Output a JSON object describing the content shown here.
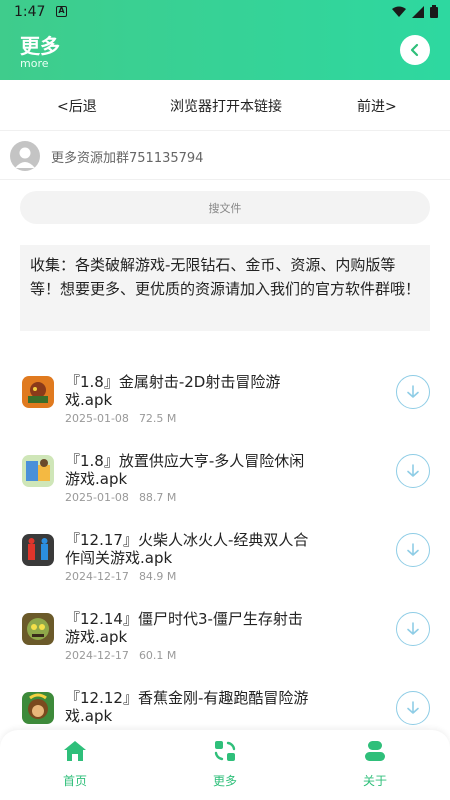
{
  "status": {
    "time": "1:47",
    "notif": "A"
  },
  "header": {
    "title": "更多",
    "subtitle": "more"
  },
  "nav": {
    "back": "<后退",
    "open_browser": "浏览器打开本链接",
    "forward": "前进>"
  },
  "notice": {
    "text": "更多资源加群751135794"
  },
  "search": {
    "placeholder": "搜文件"
  },
  "intro": {
    "text": "收集：各类破解游戏-无限钻石、金币、资源、内购版等等！想要更多、更优质的资源请加入我们的官方软件群哦！"
  },
  "files": [
    {
      "name": "『1.8』金属射击-2D射击冒险游戏.apk",
      "date": "2025-01-08",
      "size": "72.5 M",
      "icon": "metal-shooter-icon"
    },
    {
      "name": "『1.8』放置供应大亨-多人冒险休闲游戏.apk",
      "date": "2025-01-08",
      "size": "88.7 M",
      "icon": "supply-tycoon-icon"
    },
    {
      "name": "『12.17』火柴人冰火人-经典双人合作闯关游戏.apk",
      "date": "2024-12-17",
      "size": "84.9 M",
      "icon": "stickman-icon"
    },
    {
      "name": "『12.14』僵尸时代3-僵尸生存射击游戏.apk",
      "date": "2024-12-17",
      "size": "60.1 M",
      "icon": "zombie-age-icon"
    },
    {
      "name": "『12.12』香蕉金刚-有趣跑酷冒险游戏.apk",
      "date": "",
      "size": "",
      "icon": "banana-kong-icon"
    }
  ],
  "tabs": {
    "home": "首页",
    "more": "更多",
    "about": "关于"
  },
  "colors": {
    "accent": "#2fbf7a",
    "header_start": "#3fcc8c",
    "header_end": "#2ed8a0",
    "download": "#8fcde6"
  }
}
